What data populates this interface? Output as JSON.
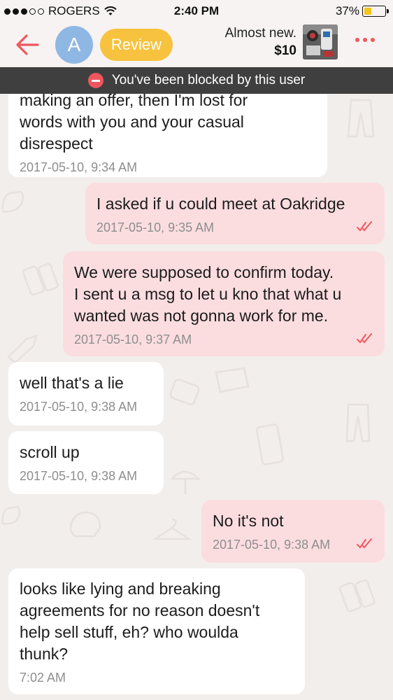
{
  "status_bar": {
    "carrier": "ROGERS",
    "time": "2:40 PM",
    "battery": "37%",
    "battery_level": 0.37
  },
  "header": {
    "back_icon": "arrow-left-icon",
    "avatar_letter": "A",
    "review_label": "Review",
    "product_title": "Almost new.",
    "product_price": "$10",
    "more_icon": "more-dots-icon"
  },
  "banner": {
    "text": "You've been blocked by this user",
    "icon": "block-icon"
  },
  "messages": [
    {
      "direction": "in",
      "text_lines": [
        "making an offer, then I'm lost for",
        "words with you and your casual",
        "disrespect"
      ],
      "timestamp": "2017-05-10, 9:34 AM"
    },
    {
      "direction": "out",
      "text_lines": [
        "I asked if u could meet at Oakridge"
      ],
      "timestamp": "2017-05-10, 9:35 AM",
      "status_icon": "double-check-icon"
    },
    {
      "direction": "out",
      "text_lines": [
        "We were supposed to confirm today.",
        "I sent u a msg to let u kno that what u",
        "wanted was not gonna work for me."
      ],
      "timestamp": "2017-05-10, 9:37 AM",
      "status_icon": "double-check-icon"
    },
    {
      "direction": "in",
      "text_lines": [
        "well that's a lie"
      ],
      "timestamp": "2017-05-10, 9:38 AM"
    },
    {
      "direction": "in",
      "text_lines": [
        "scroll up"
      ],
      "timestamp": "2017-05-10, 9:38 AM"
    },
    {
      "direction": "out",
      "text_lines": [
        "No it's not"
      ],
      "timestamp": "2017-05-10, 9:38 AM",
      "status_icon": "double-check-icon"
    },
    {
      "direction": "in",
      "text_lines": [
        "looks like lying and breaking",
        "agreements for no reason doesn't",
        "help sell stuff, eh? who woulda",
        "thunk?"
      ],
      "timestamp": "7:02 AM"
    }
  ],
  "colors": {
    "accent": "#f0565e",
    "review": "#f7c23e",
    "outgoing_bubble": "#fbdde0",
    "incoming_bubble": "#ffffff",
    "background": "#f2eeec",
    "banner": "#3f3f3f"
  }
}
